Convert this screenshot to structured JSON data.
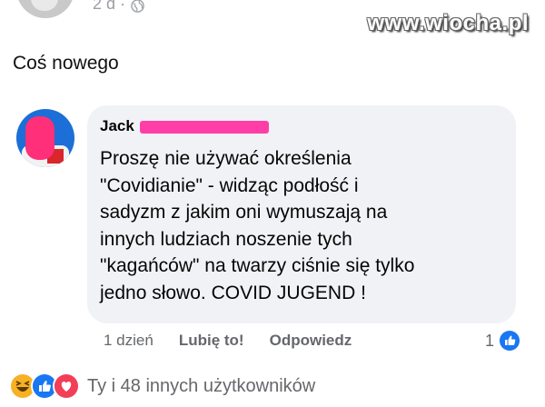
{
  "header": {
    "time_ago": "2 d ·",
    "watermark": "www.wiocha.pl"
  },
  "post": {
    "text": "Coś nowego"
  },
  "comment": {
    "author": "Jack",
    "lines": [
      "Proszę nie używać określenia",
      "\"Covidianie\" - widząc podłość i",
      "sadyzm z jakim oni wymuszają na",
      "innych ludziach noszenie tych",
      "\"kagańców\" na twarzy ciśnie się tylko",
      "jedno słowo. COVID JUGEND !"
    ],
    "time": "1 dzień",
    "like_label": "Lubię to!",
    "reply_label": "Odpowiedz",
    "like_count": "1"
  },
  "reactions": {
    "icons": [
      "haha-icon",
      "like-icon",
      "love-icon"
    ],
    "summary": "Ty i 48 innych użytkowników"
  },
  "colors": {
    "bubble": "#f0f2f5",
    "like_blue": "#1877f2",
    "love_red": "#f33e58",
    "haha_yellow": "#f7b125",
    "redaction_pink": "#ff3fa7"
  }
}
